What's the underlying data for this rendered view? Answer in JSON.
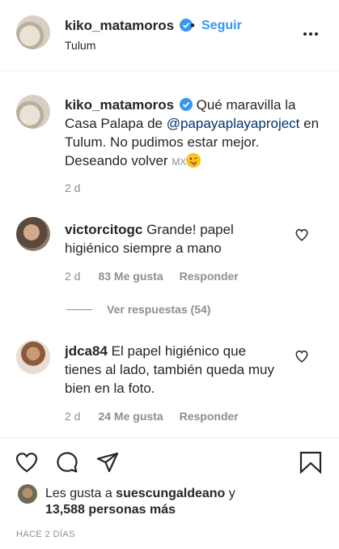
{
  "header": {
    "username": "kiko_matamoros",
    "separator": "•",
    "follow_label": "Seguir",
    "location": "Tulum"
  },
  "caption": {
    "username": "kiko_matamoros",
    "text_1": "Qué maravilla la Casa Palapa de ",
    "mention": "@papayaplayaproject",
    "text_2": " en Tulum. No pudimos estar mejor. Deseando volver ",
    "flag": "MX",
    "age": "2 d"
  },
  "comments": [
    {
      "username": "victorcitogc",
      "text": "Grande! papel higiénico siempre a mano",
      "age": "2 d",
      "likes": "83 Me gusta",
      "reply": "Responder",
      "view_replies": "Ver respuestas (54)"
    },
    {
      "username": "jdca84",
      "text": "El papel higiénico que tienes al lado, también queda muy bien en la foto.",
      "age": "2 d",
      "likes": "24 Me gusta",
      "reply": "Responder"
    }
  ],
  "likes": {
    "prefix": "Les gusta a ",
    "user": "suescungaldeano",
    "suffix": " y",
    "count_line": "13,588 personas más"
  },
  "timestamp": "HACE 2 DÍAS",
  "icons": {
    "verified": "verified-badge-icon",
    "like": "heart-icon",
    "comment": "comment-bubble-icon",
    "share": "paper-plane-icon",
    "save": "bookmark-icon",
    "more": "more-dots-icon"
  },
  "colors": {
    "link": "#3897f0",
    "mention": "#00376b",
    "verified": "#3897f0",
    "muted": "#8e8e8e"
  }
}
